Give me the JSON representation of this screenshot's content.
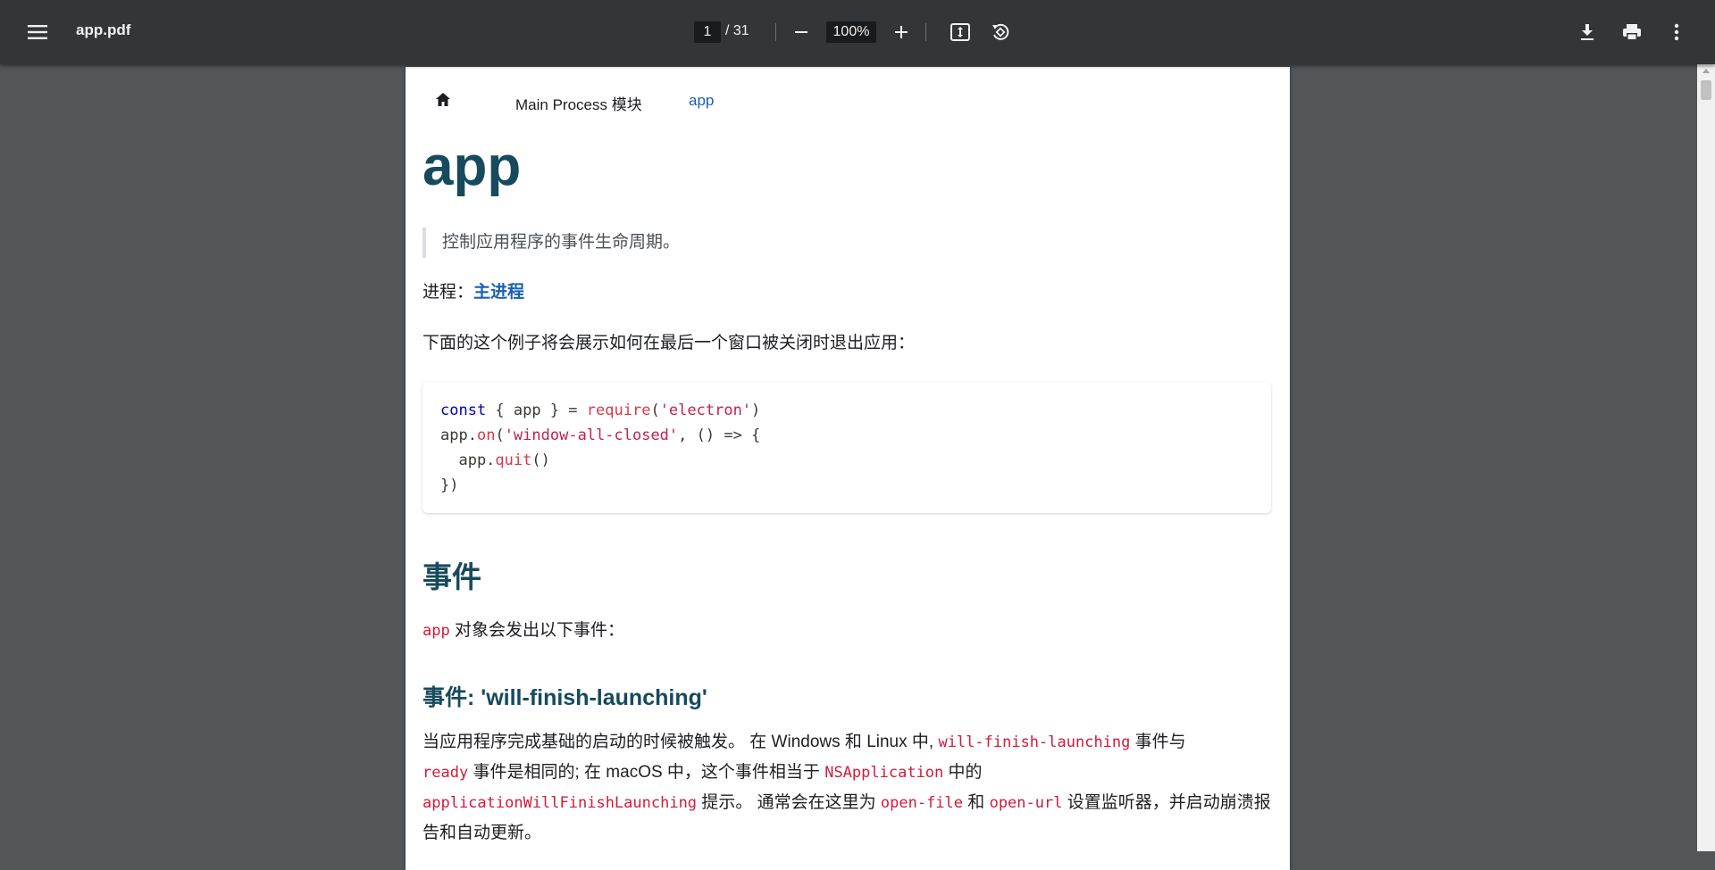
{
  "toolbar": {
    "title": "app.pdf",
    "page_current": "1",
    "page_total": "/ 31",
    "zoom": "100%"
  },
  "icons": {
    "menu": "menu-icon",
    "zoom_out": "minus-icon",
    "zoom_in": "plus-icon",
    "fit": "fit-page-icon",
    "rotate": "rotate-icon",
    "download": "download-icon",
    "print": "print-icon",
    "more": "more-vert-icon",
    "home": "home-icon"
  },
  "doc": {
    "breadcrumb": {
      "section": "Main Process 模块",
      "current": "app"
    },
    "title": "app",
    "quote": "控制应用程序的事件生命周期。",
    "process_label": "进程：",
    "process_link": "主进程",
    "intro": "下面的这个例子将会展示如何在最后一个窗口被关闭时退出应用：",
    "code": [
      "const { app } = require('electron')",
      "app.on('window-all-closed', () => {",
      "  app.quit()",
      "})"
    ],
    "events_heading": "事件",
    "events_intro_code": "app",
    "events_intro_text": " 对象会发出以下事件：",
    "event1_heading": "事件: 'will-finish-launching'",
    "event1_para": {
      "t1": "当应用程序完成基础的启动的时候被触发。 在 Windows 和 Linux 中, ",
      "c1": "will-finish-launching",
      "t2": " 事件与",
      "c2": "ready",
      "t3": " 事件是相同的; 在 macOS 中，这个事件相当于 ",
      "c3": "NSApplication",
      "t4": " 中的",
      "c4": "applicationWillFinishLaunching",
      "t5": " 提示。 通常会在这里为 ",
      "c5": "open-file",
      "t6": " 和 ",
      "c6": "open-url",
      "t7": " 设置监听器，并启动崩溃报告和自动更新。"
    }
  },
  "colors": {
    "toolbar_bg": "#323639",
    "viewer_bg": "#525659",
    "heading": "#164a5c",
    "link": "#1a5fb4",
    "inline_code": "#d31a3a"
  }
}
